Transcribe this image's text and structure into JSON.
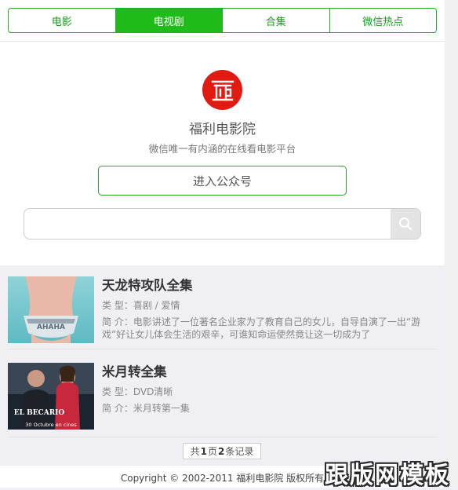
{
  "tabs": [
    {
      "label": "电影",
      "active": false
    },
    {
      "label": "电视剧",
      "active": true
    },
    {
      "label": "合集",
      "active": false
    },
    {
      "label": "微信热点",
      "active": false
    }
  ],
  "profile": {
    "logo_text": "福利",
    "title": "福利电影院",
    "subtitle": "微信唯一有内涵的在线看电影平台",
    "enter_button": "进入公众号"
  },
  "search": {
    "value": "",
    "placeholder": ""
  },
  "items": [
    {
      "title": "天龙特攻队全集",
      "type_label": "类  型：",
      "type_value": "喜剧 / 爱情",
      "desc_label": "简  介：",
      "desc_value": "电影讲述了一位著名企业家为了教育自己的女儿，自导自演了一出“游戏”好让女儿体会生活的艰辛，可谁知命运使然竟让这一切成为了"
    },
    {
      "title": "米月转全集",
      "type_label": "类  型：",
      "type_value": "DVD清晰",
      "desc_label": "简  介：",
      "desc_value": "米月转第一集",
      "poster_text": "EL BECARIO",
      "poster_sub": "30 Octubre en cines"
    }
  ],
  "pager": {
    "prefix": "共",
    "pages": "1",
    "mid": "页",
    "count": "2",
    "suffix": "条记录"
  },
  "footer": "Copyright © 2002-2011 福利电影院 版权所有",
  "watermark": "跟版网模板",
  "colors": {
    "accent": "#1fbc19",
    "logo_red": "#e21b12"
  }
}
